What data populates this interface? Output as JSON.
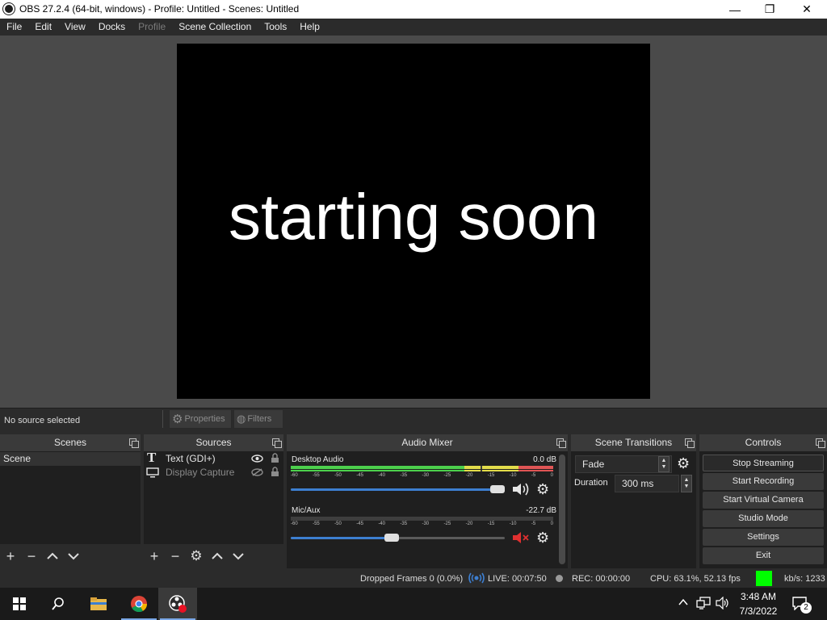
{
  "window": {
    "title": "OBS 27.2.4 (64-bit, windows) - Profile: Untitled - Scenes: Untitled",
    "minimize_glyph": "—",
    "maximize_glyph": "❐",
    "close_glyph": "✕"
  },
  "menu": [
    "File",
    "Edit",
    "View",
    "Docks",
    "Profile",
    "Scene Collection",
    "Tools",
    "Help"
  ],
  "preview": {
    "text": "starting soon"
  },
  "source_toolbar": {
    "status": "No source selected",
    "properties_label": "Properties",
    "filters_label": "Filters"
  },
  "docks": {
    "scenes": {
      "title": "Scenes",
      "items": [
        "Scene"
      ]
    },
    "sources": {
      "title": "Sources",
      "items": [
        {
          "label": "Text (GDI+)",
          "icon": "text-icon",
          "visible": true
        },
        {
          "label": "Display Capture",
          "icon": "monitor-icon",
          "visible": false
        }
      ]
    },
    "mixer": {
      "title": "Audio Mixer",
      "channels": [
        {
          "name": "Desktop Audio",
          "db": "0.0 dB",
          "volume": 1.0,
          "muted": false
        },
        {
          "name": "Mic/Aux",
          "db": "-22.7 dB",
          "volume": 0.47,
          "muted": true
        }
      ],
      "ticks": [
        "-60",
        "-55",
        "-50",
        "-45",
        "-40",
        "-35",
        "-30",
        "-25",
        "-20",
        "-15",
        "-10",
        "-5",
        "0"
      ]
    },
    "transitions": {
      "title": "Scene Transitions",
      "selected": "Fade",
      "duration_label": "Duration",
      "duration_value": "300 ms"
    },
    "controls": {
      "title": "Controls",
      "buttons": [
        "Stop Streaming",
        "Start Recording",
        "Start Virtual Camera",
        "Studio Mode",
        "Settings",
        "Exit"
      ]
    }
  },
  "status": {
    "dropped": "Dropped Frames 0 (0.0%)",
    "live": "LIVE: 00:07:50",
    "rec": "REC: 00:00:00",
    "cpu": "CPU: 63.1%, 52.13 fps",
    "kbs": "kb/s: 1233",
    "indicator_color": "#00ff00"
  },
  "taskbar": {
    "time": "3:48 AM",
    "date": "7/3/2022",
    "notification_count": "2"
  },
  "colors": {
    "accent": "#3d7fd1",
    "muted": "#e03030"
  }
}
